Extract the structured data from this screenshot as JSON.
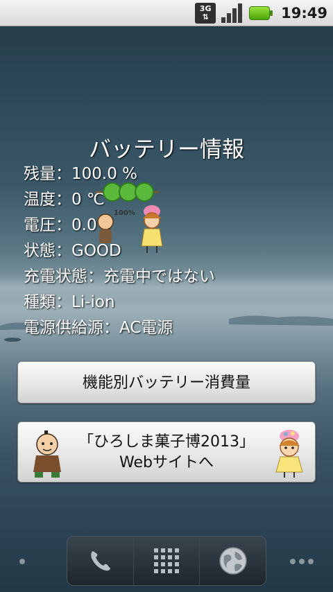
{
  "status_bar": {
    "network_top": "3G",
    "network_bottom": "⇅",
    "time": "19:49"
  },
  "widget": {
    "title": "バッテリー情報",
    "lines": [
      "残量：100.0 %",
      "温度：0 ℃",
      "電圧：0.0 V",
      "状態：GOOD",
      "充電状態：充電中ではない",
      "種類：Li-ion",
      "電源供給源：AC電源"
    ],
    "battery_badge": "100%"
  },
  "buttons": {
    "usage_label": "機能別バッテリー消費量",
    "site_line1": "「ひろしま菓子博2013」",
    "site_line2": "Webサイトへ"
  },
  "dock": {
    "icons": [
      "phone-icon",
      "app-grid-icon",
      "browser-globe-icon"
    ]
  },
  "colors": {
    "battery_green": "#6cc51c",
    "statusbar": "#e6e6e6"
  }
}
